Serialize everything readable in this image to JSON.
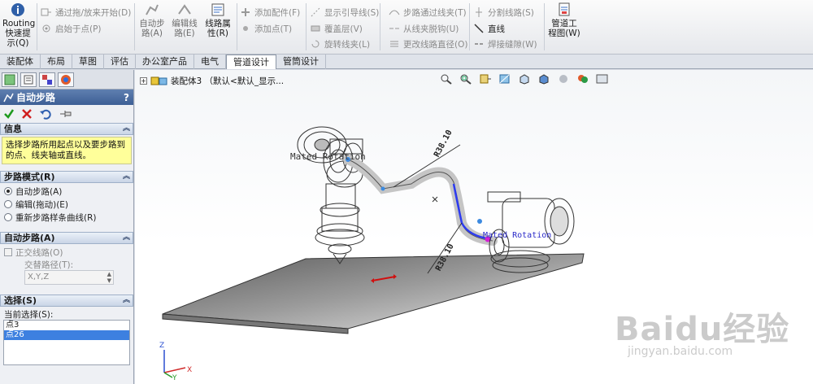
{
  "ribbon": {
    "routing_quickstart": "Routing\n快速提\n示(Q)",
    "drag_drop_start": "通过拖/放来开始(D)",
    "start_at_point": "启始于点(P)",
    "auto_route": "自动步\n路(A)",
    "edit_route": "编辑线\n路(E)",
    "route_properties": "线路属\n性(R)",
    "add_fitting": "添加配件(F)",
    "add_point": "添加点(T)",
    "show_guidelines": "显示引导线(S)",
    "cover_layer": "覆盖层(V)",
    "rotate_clip": "旋转线夹(L)",
    "route_through_clip": "步路通过线夹(T)",
    "detach_from_clip": "从线夹脱钩(U)",
    "change_route_diameter": "更改线路直径(O)",
    "split_route": "分割线路(S)",
    "line": "直线",
    "weld_gap": "焊接缝隙(W)",
    "piping_drawing": "管道工\n程图(W)"
  },
  "tabs": [
    {
      "label": "装配体",
      "active": false
    },
    {
      "label": "布局",
      "active": false
    },
    {
      "label": "草图",
      "active": false
    },
    {
      "label": "评估",
      "active": false
    },
    {
      "label": "办公室产品",
      "active": false
    },
    {
      "label": "电气",
      "active": false
    },
    {
      "label": "管道设计",
      "active": true
    },
    {
      "label": "管筒设计",
      "active": false
    }
  ],
  "property_manager": {
    "title": "自动步路",
    "help": "?",
    "info": {
      "title": "信息",
      "message": "选择步路所用起点以及要步路到的点、线夹轴或直线。"
    },
    "route_mode": {
      "title": "步路模式(R)",
      "options": [
        {
          "label": "自动步路(A)",
          "selected": true
        },
        {
          "label": "编辑(拖动)(E)",
          "selected": false
        },
        {
          "label": "重新步路样条曲线(R)",
          "selected": false
        }
      ]
    },
    "auto_route": {
      "title": "自动步路(A)",
      "orthogonal_label": "正交线路(O)",
      "alt_path_label": "交替路径(T):",
      "alt_path_value": "X,Y,Z"
    },
    "selections": {
      "title": "选择(S)",
      "current_label": "当前选择(S):",
      "items": [
        "点3",
        "点26"
      ]
    }
  },
  "graphics": {
    "tree_label": "装配体3 （默认<默认_显示...",
    "annotations": {
      "rotation_top": "Mated Rotation",
      "rotation_bottom": "Mated Rotation",
      "radius_top": "R38.10",
      "radius_bottom": "R38.10"
    },
    "axis": {
      "x": "X",
      "y": "Y",
      "z": "Z"
    }
  },
  "watermark": {
    "brand": "Baidu经验",
    "url": "jingyan.baidu.com"
  }
}
